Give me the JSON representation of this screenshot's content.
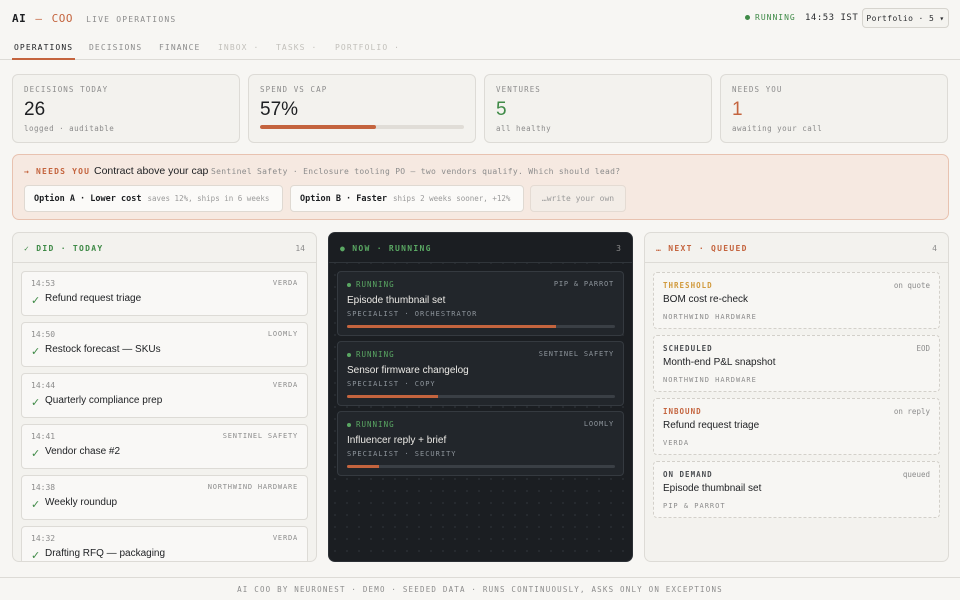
{
  "header": {
    "brand_ai": "AI",
    "brand_dash": "—",
    "brand_coo": "COO",
    "brand_sub": "LIVE OPERATIONS",
    "status": "RUNNING",
    "time": "14:53 IST",
    "portfolio": "Portfolio · 5 ▾"
  },
  "tabs": [
    {
      "label": "OPERATIONS",
      "state": "active"
    },
    {
      "label": "DECISIONS",
      "state": "normal"
    },
    {
      "label": "FINANCE",
      "state": "normal"
    },
    {
      "label": "INBOX ·",
      "state": "dim"
    },
    {
      "label": "TASKS ·",
      "state": "dim"
    },
    {
      "label": "PORTFOLIO ·",
      "state": "dim"
    }
  ],
  "stats": {
    "decisions": {
      "label": "DECISIONS TODAY",
      "value": "26",
      "sub": "logged · auditable"
    },
    "spend": {
      "label": "SPEND VS CAP",
      "value": "57%",
      "progress": 0.57
    },
    "ventures": {
      "label": "VENTURES",
      "value": "5",
      "sub": "all healthy"
    },
    "needs": {
      "label": "NEEDS YOU",
      "value": "1",
      "sub": "awaiting your call"
    }
  },
  "banner": {
    "tag": "→ NEEDS YOU",
    "title": "Contract above your cap",
    "desc": "Sentinel Safety · Enclosure tooling PO — two vendors qualify. Which should lead?",
    "option_a_label": "Option A · Lower cost",
    "option_a_note": "saves 12%, ships in 6 weeks",
    "option_b_label": "Option B · Faster",
    "option_b_note": "ships 2 weeks sooner, +12%",
    "write_own": "…write your own"
  },
  "done": {
    "title": "✓ DID · TODAY",
    "count": "14",
    "items": [
      {
        "time": "14:53",
        "org": "VERDA",
        "title": "Refund request triage"
      },
      {
        "time": "14:50",
        "org": "LOOMLY",
        "title": "Restock forecast — SKUs"
      },
      {
        "time": "14:44",
        "org": "VERDA",
        "title": "Quarterly compliance prep"
      },
      {
        "time": "14:41",
        "org": "SENTINEL SAFETY",
        "title": "Vendor chase #2"
      },
      {
        "time": "14:38",
        "org": "NORTHWIND HARDWARE",
        "title": "Weekly roundup"
      },
      {
        "time": "14:32",
        "org": "VERDA",
        "title": "Drafting RFQ — packaging"
      }
    ]
  },
  "now": {
    "title": "● NOW · RUNNING",
    "count": "3",
    "items": [
      {
        "status": "RUNNING",
        "org": "PIP & PARROT",
        "title": "Episode thumbnail set",
        "meta": "SPECIALIST · ORCHESTRATOR",
        "progress": 0.78
      },
      {
        "status": "RUNNING",
        "org": "SENTINEL SAFETY",
        "title": "Sensor firmware changelog",
        "meta": "SPECIALIST · COPY",
        "progress": 0.34
      },
      {
        "status": "RUNNING",
        "org": "LOOMLY",
        "title": "Influencer reply + brief",
        "meta": "SPECIALIST · SECURITY",
        "progress": 0.12
      }
    ]
  },
  "next": {
    "title": "… NEXT · QUEUED",
    "count": "4",
    "items": [
      {
        "kind": "THRESHOLD",
        "tone": "amber",
        "cond": "on quote",
        "title": "BOM cost re-check",
        "org": "NORTHWIND HARDWARE"
      },
      {
        "kind": "SCHEDULED",
        "tone": "plain",
        "cond": "EOD",
        "title": "Month-end P&L snapshot",
        "org": "NORTHWIND HARDWARE"
      },
      {
        "kind": "INBOUND",
        "tone": "orange",
        "cond": "on reply",
        "title": "Refund request triage",
        "org": "VERDA"
      },
      {
        "kind": "ON DEMAND",
        "tone": "plain",
        "cond": "queued",
        "title": "Episode thumbnail set",
        "org": "PIP & PARROT"
      }
    ]
  },
  "footer": "AI COO BY NEURONEST · DEMO · SEEDED DATA · RUNS CONTINUOUSLY, ASKS ONLY ON EXCEPTIONS",
  "colors": {
    "accent": "#c4643e",
    "running": "#3f8a47",
    "dark_panel": "#1b1e22",
    "background": "#f7f6f3"
  }
}
